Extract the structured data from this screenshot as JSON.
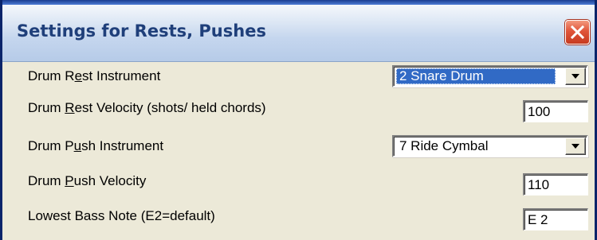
{
  "window": {
    "title": "Settings for Rests, Pushes"
  },
  "settings": [
    {
      "label_before": "Drum R",
      "label_mnemonic": "e",
      "label_after": "st Instrument",
      "control": "dropdown",
      "value": "2 Snare Drum",
      "focused": true
    },
    {
      "label_before": "Drum ",
      "label_mnemonic": "R",
      "label_after": "est Velocity (shots/ held chords)",
      "control": "number",
      "value": "100"
    },
    {
      "label_before": "Drum P",
      "label_mnemonic": "u",
      "label_after": "sh Instrument",
      "control": "dropdown",
      "value": "7 Ride Cymbal"
    },
    {
      "label_before": "Drum ",
      "label_mnemonic": "P",
      "label_after": "ush Velocity",
      "control": "number",
      "value": "110"
    },
    {
      "label_before": "Lowest Bass Note (E2=default)",
      "label_mnemonic": "",
      "label_after": "",
      "control": "number",
      "value": "E 2"
    }
  ],
  "icons": {
    "close": "close-icon",
    "dropdown": "chevron-down-icon"
  },
  "colors": {
    "selection": "#316ac5",
    "close_button": "#e0553a",
    "dialog_background": "#ece9d8"
  }
}
